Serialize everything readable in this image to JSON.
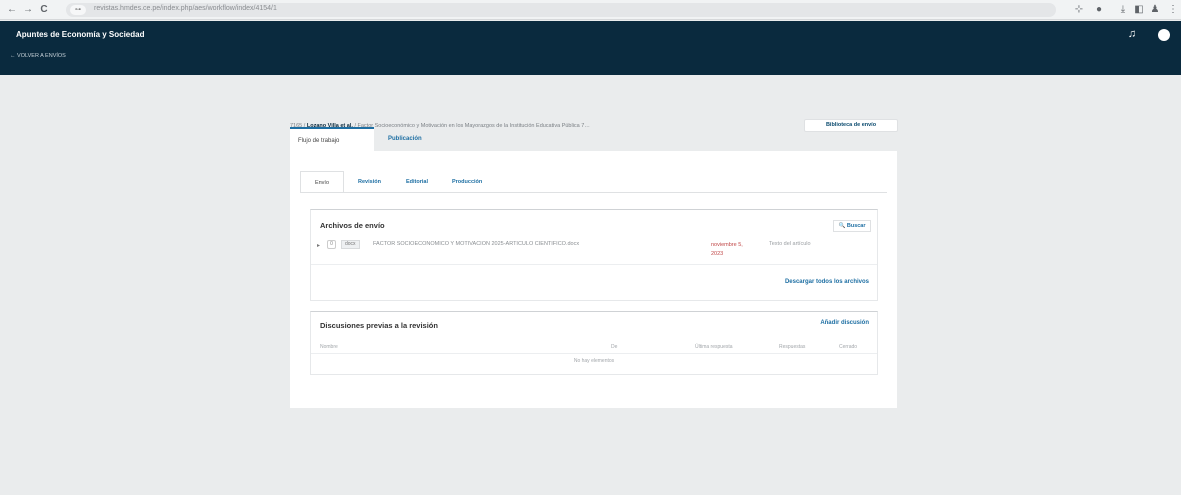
{
  "browser": {
    "back": "←",
    "forward": "→",
    "reload": "C",
    "url_info": "⊶",
    "url": "revistas.hmdes.ce.pe/index.php/aes/workflow/index/4154/1"
  },
  "header": {
    "site_title": "Apuntes de Economía y Sociedad",
    "back_link": "← VOLVER A ENVÍOS"
  },
  "breadcrumb": {
    "id": "7165",
    "author": "Lozano Villa et al.",
    "title": "/ Factor Socioeconómico y Motivación en los Mayorazgos de la Institución Educativa Pública 7…",
    "library_button": "Biblioteca de envío"
  },
  "outer_tabs": [
    {
      "label": "Flujo de trabajo"
    },
    {
      "label": "Publicación"
    }
  ],
  "inner_tabs": [
    {
      "label": "Envío"
    },
    {
      "label": "Revisión"
    },
    {
      "label": "Editorial"
    },
    {
      "label": "Producción"
    }
  ],
  "submission_files": {
    "title": "Archivos de envío",
    "search_label": "🔍 Buscar",
    "row": {
      "chevron": "▸",
      "id": "0",
      "ext": "docx",
      "name": "FACTOR SOCIOECONÓMICO Y MOTIVACIÓN 2025-ARTÍCULO CIENTÍFICO.docx",
      "date": "noviembre 5, 2023",
      "type": "Texto del artículo"
    },
    "download_all": "Descargar todos los archivos"
  },
  "discussions": {
    "title": "Discusiones previas a la revisión",
    "add_label": "Añadir discusión",
    "columns": [
      "Nombre",
      "De",
      "Última respuesta",
      "Respuestas",
      "Cerrado"
    ],
    "empty_text": "No hay elementos"
  },
  "colors": {
    "header_bg": "#0a2a3e",
    "link": "#1e6fa3",
    "date_alert": "#c14848",
    "page_bg": "#eaeced"
  }
}
